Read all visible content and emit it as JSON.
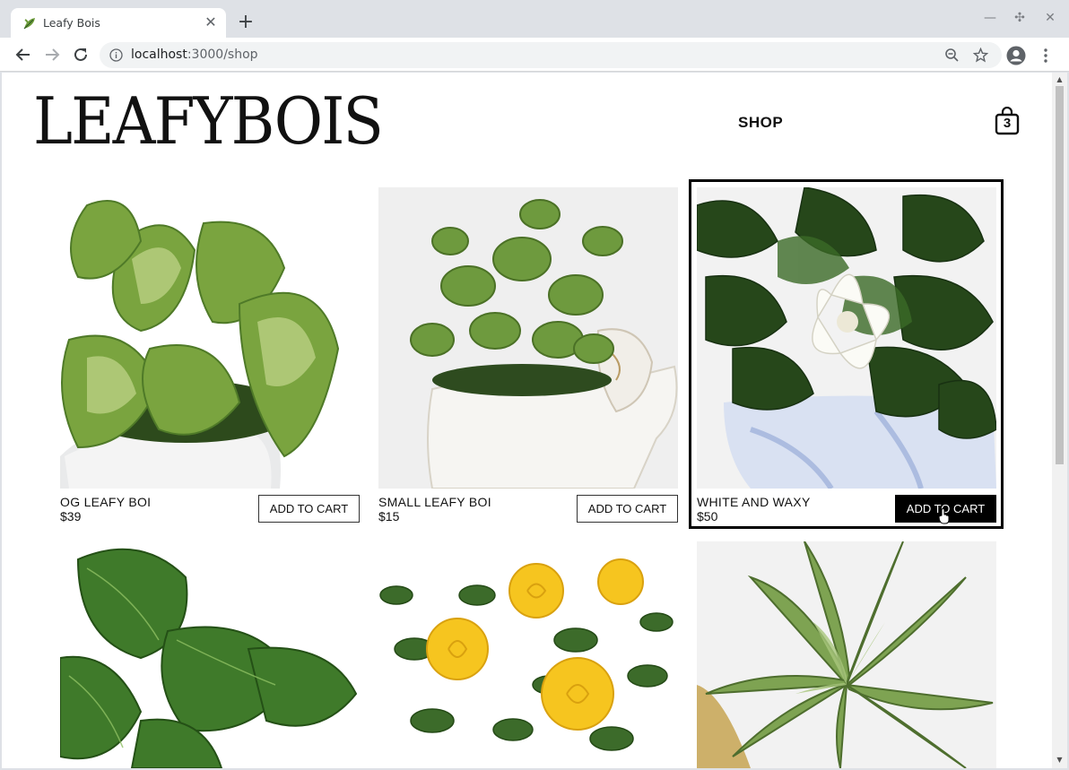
{
  "browser": {
    "tab_title": "Leafy Bois",
    "url_host": "localhost",
    "url_path": ":3000/shop",
    "new_tab_label": "+",
    "tab_close_label": "✕"
  },
  "site": {
    "logo": "LEAFYBOIS",
    "nav_shop": "SHOP",
    "cart_count": "3"
  },
  "products": [
    {
      "name": "OG LEAFY BOI",
      "price": "$39",
      "button": "ADD TO CART",
      "icon": "pothos-plant-photo"
    },
    {
      "name": "SMALL LEAFY BOI",
      "price": "$15",
      "button": "ADD TO CART",
      "icon": "jade-plant-elephant-pot-photo"
    },
    {
      "name": "WHITE AND WAXY",
      "price": "$50",
      "button": "ADD TO CART",
      "icon": "gardenia-plant-photo",
      "hovered": true
    },
    {
      "icon": "fiddle-leaf-fig-photo"
    },
    {
      "icon": "yellow-roses-photo"
    },
    {
      "icon": "succulent-photo"
    }
  ],
  "colors": {
    "accent": "#000000",
    "leaf_dark": "#2f5a22",
    "leaf_light": "#7fa84a",
    "rose": "#f6c51f"
  }
}
